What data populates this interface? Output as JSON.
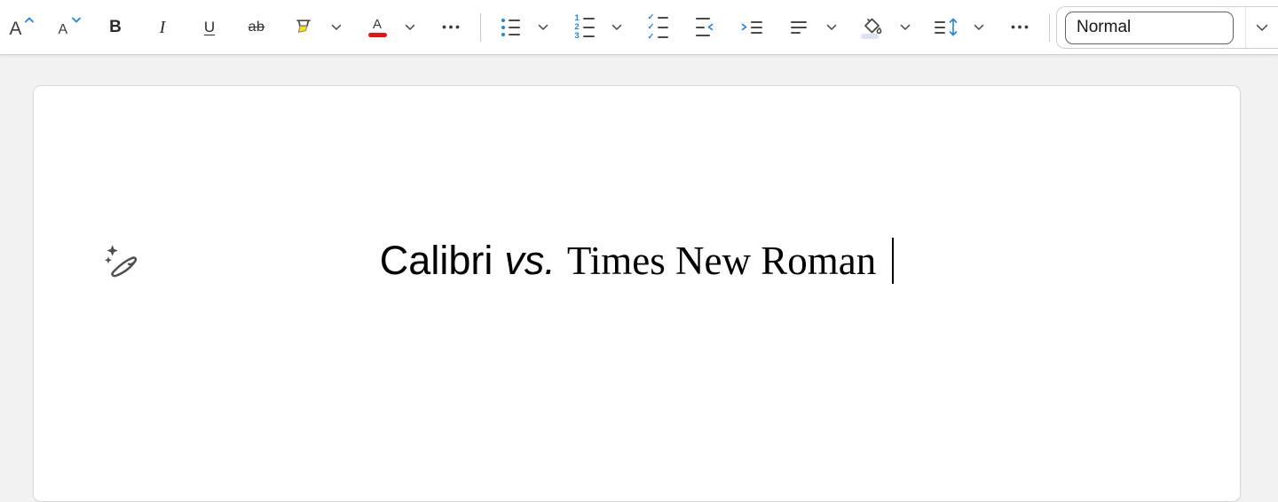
{
  "colors": {
    "accent_blue": "#1E86E5",
    "font_color_swatch_red": "#ED1111",
    "highlighter_yellow": "#FFE100",
    "shading_swatch_lavender": "#DCE3F5",
    "toolbar_background": "#FFFFFF",
    "canvas_background": "#F2F2F2",
    "page_background": "#FFFFFF"
  },
  "toolbar": {
    "grow_font_letter": "A",
    "shrink_font_letter": "A",
    "bold_label": "B",
    "italic_label": "I",
    "underline_label": "U",
    "strikethrough_label": "ab",
    "font_color_letter": "A",
    "numbered_list_digits": [
      "1",
      "2",
      "3"
    ],
    "check_glyph": "✓",
    "style_selector_value": "Normal"
  },
  "icons": {
    "grow-font-caret": "chevron-up",
    "shrink-font-caret": "chevron-down",
    "highlighter-icon": "marker-with-yellow-tip",
    "font-color-icon": "A-over-red-bar",
    "more-options-icon": "three-dots",
    "bullet-list-icon": "dots-and-lines",
    "numbered-list-icon": "123-and-lines",
    "checklist-icon": "checks-and-lines",
    "outdent-icon": "lines-with-left-arrow",
    "indent-icon": "lines-with-right-arrow",
    "align-icon": "three-lines",
    "shading-icon": "paint-bucket-with-droplet",
    "line-spacing-icon": "lines-with-up-down-arrows",
    "dropdown-chevron": "chevron-down",
    "copilot-pen-icon": "pen-with-sparkles",
    "text-cursor": "vertical-bar"
  },
  "document": {
    "title_sans": "Calibri",
    "title_italic": "vs.",
    "title_serif": "Times New Roman"
  }
}
